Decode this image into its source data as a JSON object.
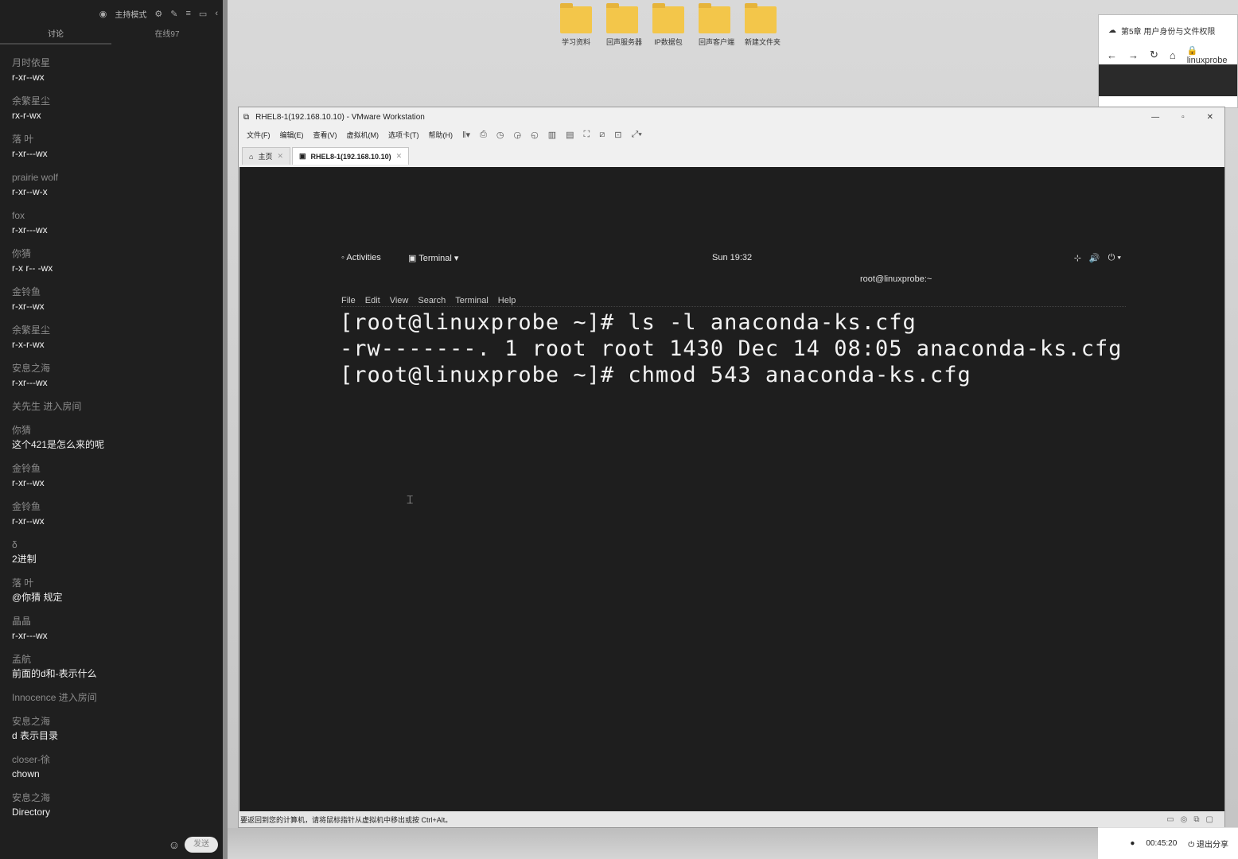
{
  "chat": {
    "header": {
      "mode_label": "主持模式",
      "icons": [
        "settings-icon",
        "edit-icon",
        "menu-icon",
        "minimize-icon",
        "collapse-icon"
      ]
    },
    "tabs": [
      "讨论",
      "在线97"
    ],
    "messages": [
      {
        "who": "月时依星",
        "text": "r-xr--wx"
      },
      {
        "who": "余繁星尘",
        "text": "rx-r-wx"
      },
      {
        "who": "   落   叶",
        "text": "r-xr---wx"
      },
      {
        "who": "prairie wolf",
        "text": "r-xr--w-x"
      },
      {
        "who": "fox",
        "text": "r-xr---wx"
      },
      {
        "who": "你猜",
        "text": "r-x r-- -wx"
      },
      {
        "who": "金铃鱼",
        "text": "r-xr--wx"
      },
      {
        "who": "余繁星尘",
        "text": "r-x-r-wx"
      },
      {
        "who": "安息之海",
        "text": "r-xr---wx"
      },
      {
        "who": "关先生 进入房间",
        "text": ""
      },
      {
        "who": "你猜",
        "text": "这个421是怎么来的呢"
      },
      {
        "who": "金铃鱼",
        "text": "r-xr--wx"
      },
      {
        "who": "金铃鱼",
        "text": "r-xr--wx"
      },
      {
        "who": "δ",
        "text": "2进制"
      },
      {
        "who": "   落   叶",
        "text": "@你猜 规定"
      },
      {
        "who": "晶晶",
        "text": "r-xr---wx"
      },
      {
        "who": "孟航",
        "text": "前面的d和-表示什么"
      },
      {
        "who": "Innocence 进入房间",
        "text": ""
      },
      {
        "who": "安息之海",
        "text": "d 表示目录"
      },
      {
        "who": "closer-徐",
        "text": "chown"
      },
      {
        "who": "安息之海",
        "text": "Directory"
      }
    ],
    "send_label": "发送"
  },
  "desktop": {
    "icons": [
      "学习资料",
      "回声服务器",
      "IP数据包",
      "回声客户端",
      "新建文件夹"
    ]
  },
  "browser": {
    "tab_title": "第5章 用户身份与文件权限",
    "url": "linuxprobe"
  },
  "vmware": {
    "title": "RHEL8-1(192.168.10.10) - VMware Workstation",
    "menus": [
      "文件(F)",
      "编辑(E)",
      "查看(V)",
      "虚拟机(M)",
      "选项卡(T)",
      "帮助(H)"
    ],
    "tabs": [
      {
        "label": "主页",
        "active": false
      },
      {
        "label": "RHEL8-1(192.168.10.10)",
        "active": true
      }
    ],
    "status_text": "要返回到您的计算机，请将鼠标指针从虚拟机中移出或按 Ctrl+Alt。"
  },
  "gnome": {
    "activities": "Activities",
    "app_menu": "Terminal",
    "clock": "Sun 19:32"
  },
  "terminal": {
    "title": "root@linuxprobe:~",
    "menu": [
      "File",
      "Edit",
      "View",
      "Search",
      "Terminal",
      "Help"
    ],
    "lines": [
      "[root@linuxprobe ~]# ls -l anaconda-ks.cfg",
      "-rw-------. 1 root root 1430 Dec 14 08:05 anaconda-ks.cfg",
      "[root@linuxprobe ~]# chmod 543 anaconda-ks.cfg"
    ]
  },
  "taskbar": {
    "time": "00:45:20",
    "share_label": "退出分享"
  }
}
